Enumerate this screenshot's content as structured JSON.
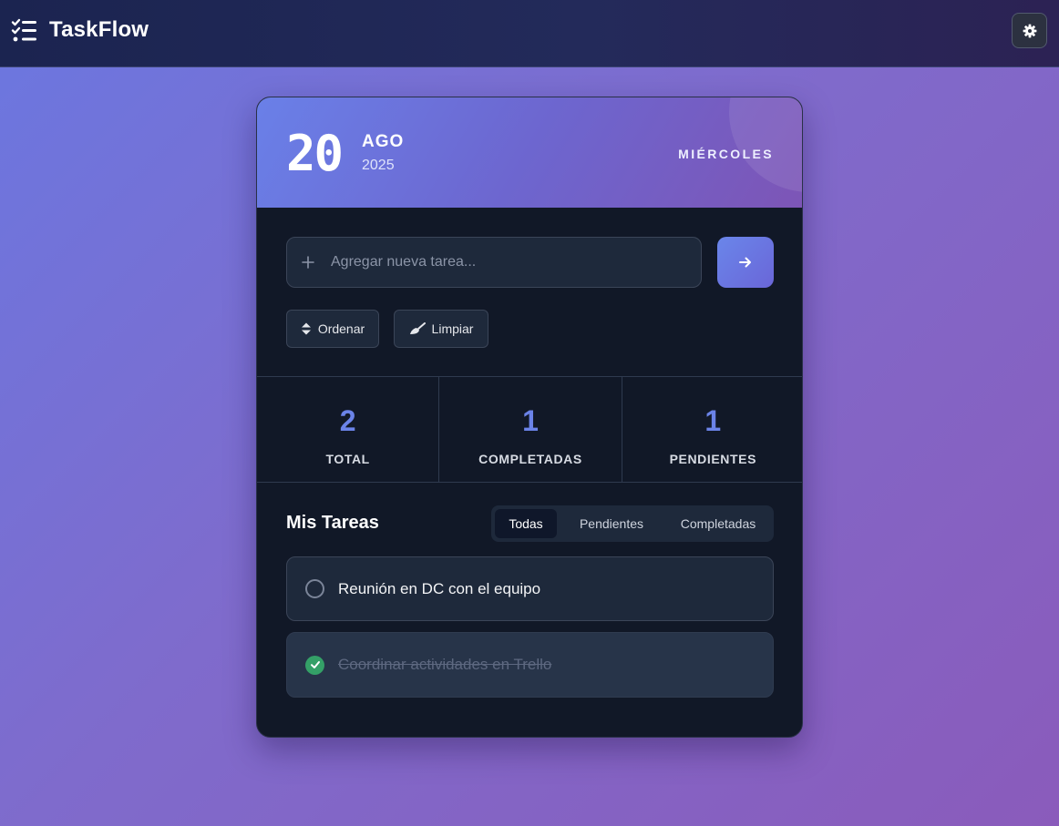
{
  "app": {
    "name": "TaskFlow",
    "icons": {
      "logo": "task-list-icon",
      "settings": "gear-icon"
    }
  },
  "date": {
    "day": "20",
    "month": "AGO",
    "year": "2025",
    "weekday": "MIÉRCOLES"
  },
  "input": {
    "placeholder": "Agregar nueva tarea...",
    "value": "",
    "icons": {
      "leading": "plus-icon",
      "submit": "arrow-right-icon"
    }
  },
  "toolbar": {
    "sort_label": "Ordenar",
    "clear_label": "Limpiar",
    "icons": {
      "sort": "sort-icon",
      "clear": "broom-icon"
    }
  },
  "stats": [
    {
      "value": "2",
      "label": "TOTAL"
    },
    {
      "value": "1",
      "label": "COMPLETADAS"
    },
    {
      "value": "1",
      "label": "PENDIENTES"
    }
  ],
  "tasks_section": {
    "title": "Mis Tareas",
    "filters": [
      {
        "label": "Todas",
        "active": true
      },
      {
        "label": "Pendientes",
        "active": false
      },
      {
        "label": "Completadas",
        "active": false
      }
    ],
    "items": [
      {
        "text": "Reunión en DC con el equipo",
        "completed": false
      },
      {
        "text": "Coordinar actividades en Trello",
        "completed": true
      }
    ]
  },
  "colors": {
    "accent": "#6b83e8",
    "success": "#34a067",
    "card_bg": "#111827",
    "header_gradient": [
      "#6a80e8",
      "#7d55b6"
    ]
  }
}
